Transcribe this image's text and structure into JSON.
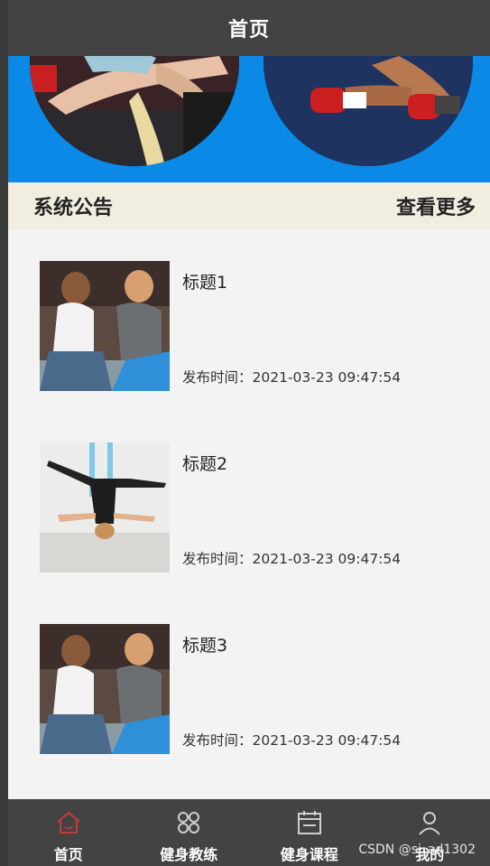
{
  "header": {
    "title": "首页"
  },
  "notice": {
    "label": "系统公告",
    "more": "查看更多"
  },
  "announcements": [
    {
      "title": "标题1",
      "time": "发布时间：2021-03-23 09:47:54"
    },
    {
      "title": "标题2",
      "time": "发布时间：2021-03-23 09:47:54"
    },
    {
      "title": "标题3",
      "time": "发布时间：2021-03-23 09:47:54"
    }
  ],
  "tabbar": {
    "tabs": [
      {
        "label": "首页",
        "icon": "home-icon"
      },
      {
        "label": "健身教练",
        "icon": "grid-icon"
      },
      {
        "label": "健身课程",
        "icon": "calendar-icon"
      },
      {
        "label": "我的",
        "icon": "user-icon"
      }
    ],
    "active_color": "#c53a3a"
  },
  "watermark": "CSDN @sj_ad1302"
}
